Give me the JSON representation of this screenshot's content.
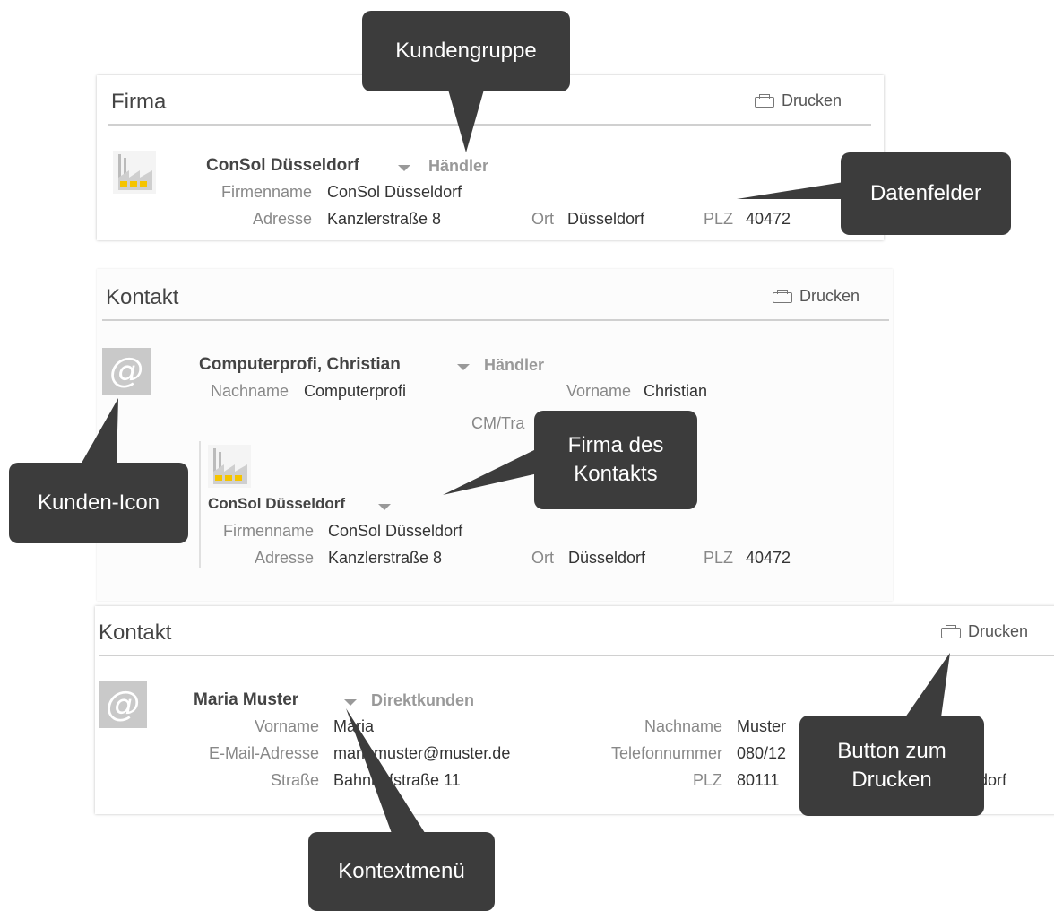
{
  "firma_section": {
    "title": "Firma",
    "print_label": "Drucken",
    "name": "ConSol Düsseldorf",
    "group": "Händler",
    "fields": [
      {
        "label": "Firmenname",
        "value": "ConSol Düsseldorf"
      },
      {
        "label": "Adresse",
        "value": "Kanzlerstraße 8"
      },
      {
        "label": "Ort",
        "value": "Düsseldorf"
      },
      {
        "label": "PLZ",
        "value": "40472"
      }
    ]
  },
  "kontakt1_section": {
    "title": "Kontakt",
    "print_label": "Drucken",
    "icon": "@",
    "name": "Computerprofi, Christian",
    "group": "Händler",
    "fields": [
      {
        "label": "Nachname",
        "value": "Computerprofi"
      },
      {
        "label": "Vorname",
        "value": "Christian"
      },
      {
        "label": "CM/Tra",
        "value": ""
      }
    ],
    "company": {
      "name": "ConSol Düsseldorf",
      "fields": [
        {
          "label": "Firmenname",
          "value": "ConSol Düsseldorf"
        },
        {
          "label": "Adresse",
          "value": "Kanzlerstraße 8"
        },
        {
          "label": "Ort",
          "value": "Düsseldorf"
        },
        {
          "label": "PLZ",
          "value": "40472"
        }
      ]
    }
  },
  "kontakt2_section": {
    "title": "Kontakt",
    "print_label": "Drucken",
    "icon": "@",
    "name": "Maria Muster",
    "group": "Direktkunden",
    "fields": [
      {
        "label": "Vorname",
        "value": "Maria"
      },
      {
        "label": "Nachname",
        "value": "Muster"
      },
      {
        "label": "E-Mail-Adresse",
        "value": "mariamuster@muster.de"
      },
      {
        "label": "Telefonnummer",
        "value": "080/12"
      },
      {
        "label": "Straße",
        "value": "Bahnhofstraße 11"
      },
      {
        "label": "PLZ",
        "value": "80111"
      },
      {
        "label": "",
        "value": "dorf"
      }
    ]
  },
  "callouts": {
    "kundengruppe": "Kundengruppe",
    "datenfelder": "Datenfelder",
    "kunden_icon": "Kunden-Icon",
    "firma_des_kontakts": "Firma des Kontakts",
    "button_zum_drucken": "Button zum Drucken",
    "kontextmenue": "Kontextmenü"
  },
  "colors": {
    "callout_bg": "#3c3c3c",
    "label": "#888888",
    "group": "#999999",
    "icon_bg": "#c9c9c9",
    "factory_yellow": "#f5c400"
  }
}
